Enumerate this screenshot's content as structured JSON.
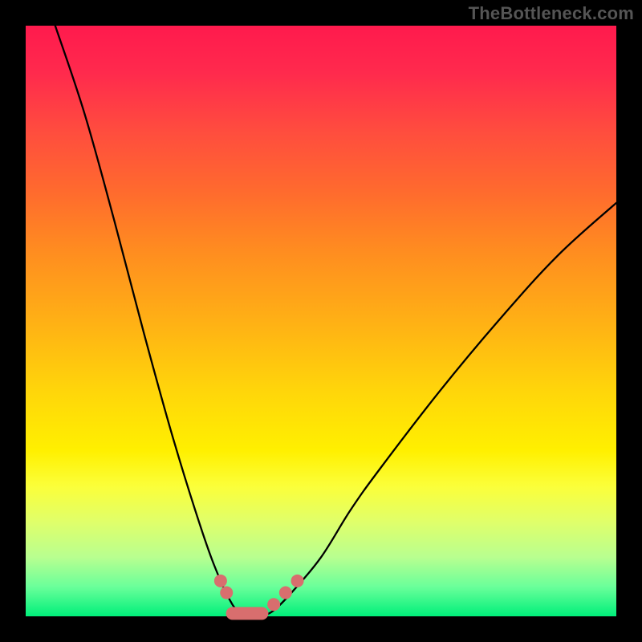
{
  "attribution": "TheBottleneck.com",
  "chart_data": {
    "type": "line",
    "title": "",
    "xlabel": "",
    "ylabel": "",
    "ylim": [
      0,
      100
    ],
    "xlim": [
      0,
      100
    ],
    "series": [
      {
        "name": "left-curve",
        "x": [
          5,
          10,
          15,
          20,
          25,
          30,
          33,
          35,
          36,
          37
        ],
        "values": [
          100,
          85,
          67,
          48,
          30,
          14,
          6,
          2,
          1,
          0
        ]
      },
      {
        "name": "right-curve",
        "x": [
          40,
          42,
          45,
          50,
          55,
          60,
          70,
          80,
          90,
          100
        ],
        "values": [
          0,
          1,
          4,
          10,
          18,
          25,
          38,
          50,
          61,
          70
        ]
      }
    ],
    "annotations": {
      "dots_left": [
        {
          "x": 33,
          "y": 6
        },
        {
          "x": 34,
          "y": 4
        }
      ],
      "dots_right": [
        {
          "x": 42,
          "y": 2
        },
        {
          "x": 44,
          "y": 4
        },
        {
          "x": 46,
          "y": 6
        }
      ],
      "trough_bar": {
        "x0": 35,
        "x1": 40,
        "y": 0.5
      }
    },
    "colors": {
      "curve": "#000000",
      "marker": "#d86e6e",
      "gradient_top": "#ff1a4d",
      "gradient_bottom": "#00ef7a"
    }
  }
}
